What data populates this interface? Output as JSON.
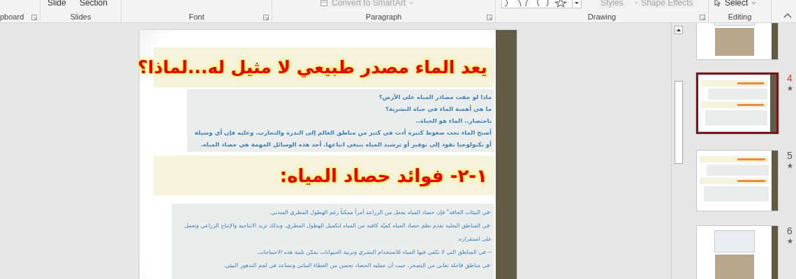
{
  "ribbon": {
    "clipboard": {
      "label": "pboard"
    },
    "slides": {
      "label": "Slides",
      "slide_button": {
        "label": "Slide",
        "disabled": false
      },
      "section_button": {
        "label": "Section",
        "disabled": false
      }
    },
    "font": {
      "label": "Font"
    },
    "paragraph": {
      "label": "Paragraph",
      "smartart_button": {
        "label": "Convert to SmartArt",
        "disabled": true
      }
    },
    "drawing": {
      "label": "Drawing",
      "styles_button": {
        "label": "Styles",
        "disabled": true
      },
      "effects_button": {
        "label": "Shape Effects",
        "disabled": true
      }
    },
    "editing": {
      "label": "Editing",
      "select_button": {
        "label": "Select",
        "disabled": false
      }
    }
  },
  "slide": {
    "title": "يعد الماء مصدر طبيعي لا مثيل له...لماذا؟",
    "intro_lines": [
      "ماذا لو جفت مصادر المياه على الأرض؟",
      "ما هي أهمية الماء في حياة البشرية؟",
      "باختصار.. الماء هو الحياة..",
      "أصبح الماء تحت ضغوط كثيرة أدت في كثير من مناطق العالم إلى الندرة والتحارب. وعليه فإن أي وسيلة أو تكنولوجيا تقود إلى توفير أو ترشيد المياه ينبغي اتباعها. أحد هذه الوسائل المهمة هي حصاد المياه."
    ],
    "heading": "١-٢- فوائد حصاد المياه:",
    "bullets": [
      "-في البيئات الجافة\" فإن حصاد المياه يجعل من الزراعة أمراً ممكناً رغم الهطول المطري المتدني.",
      "-في المناطق البعلية تقدم نظم حصاد المياه كميّة كافية من المياه لتكميل الهطول المطري. وبذلك تزيد الانتاجية والإنتاج  الزراعي وتعمل على استقراره.",
      "-- في المناطق التي لا تكفي فيها المياه للاستخدام البشري وتربية الحيوانات يمكن تلبية هذه الاحتياجات.",
      "-في مناطق قاحلة تعاني من التصحر، حيث أن عملية الحصاد تحسن من الغطاء النباتي وتساعد في لجم التدهور البيئي."
    ]
  },
  "thumbnails": [
    {
      "kind": "picture",
      "selected": false
    },
    {
      "kind": "text",
      "number": "4",
      "selected": true
    },
    {
      "kind": "text",
      "number": "5",
      "selected": false
    },
    {
      "kind": "picture",
      "number": "6",
      "selected": false
    }
  ]
}
